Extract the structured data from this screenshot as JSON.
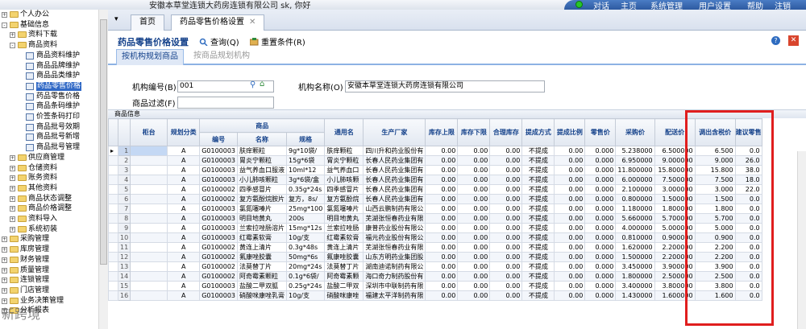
{
  "topbar": {
    "company_user": "安徽本草堂连锁大药房连锁有限公司   sk, 你好",
    "nav": [
      "对话",
      "主页",
      "系统管理",
      "用户设置",
      "帮助",
      "注销"
    ]
  },
  "sidebar": {
    "items": [
      {
        "label": "个人办公",
        "type": "folder",
        "level": 0,
        "expand": "+"
      },
      {
        "label": "基础信息",
        "type": "folder",
        "level": 0,
        "expand": "-"
      },
      {
        "label": "资料下载",
        "type": "folder",
        "level": 1,
        "expand": "+"
      },
      {
        "label": "商品资料",
        "type": "folder",
        "level": 1,
        "expand": "-"
      },
      {
        "label": "商品资料维护",
        "type": "doc",
        "level": 2
      },
      {
        "label": "商品品牌维护",
        "type": "doc",
        "level": 2
      },
      {
        "label": "商品品类维护",
        "type": "doc",
        "level": 2
      },
      {
        "label": "药品零售价格",
        "type": "doc",
        "level": 2,
        "selected": true
      },
      {
        "label": "药品零售价格",
        "type": "doc",
        "level": 2
      },
      {
        "label": "商品条码维护",
        "type": "doc",
        "level": 2
      },
      {
        "label": "价签条码打印",
        "type": "doc",
        "level": 2
      },
      {
        "label": "商品批号效期",
        "type": "doc",
        "level": 2
      },
      {
        "label": "商品批号新增",
        "type": "doc",
        "level": 2
      },
      {
        "label": "商品批号管理",
        "type": "doc",
        "level": 2
      },
      {
        "label": "供应商管理",
        "type": "folder",
        "level": 1,
        "expand": "+"
      },
      {
        "label": "仓储资料",
        "type": "folder",
        "level": 1,
        "expand": "+"
      },
      {
        "label": "账务资料",
        "type": "folder",
        "level": 1,
        "expand": "+"
      },
      {
        "label": "其他资料",
        "type": "folder",
        "level": 1,
        "expand": "+"
      },
      {
        "label": "商品状态调整",
        "type": "folder",
        "level": 1,
        "expand": "+"
      },
      {
        "label": "商品价格调整",
        "type": "folder",
        "level": 1,
        "expand": "+"
      },
      {
        "label": "资料导入",
        "type": "folder",
        "level": 1,
        "expand": "+"
      },
      {
        "label": "系统初装",
        "type": "folder",
        "level": 1,
        "expand": "+"
      },
      {
        "label": "采购管理",
        "type": "folder",
        "level": 0,
        "expand": "+"
      },
      {
        "label": "库房管理",
        "type": "folder",
        "level": 0,
        "expand": "+"
      },
      {
        "label": "财务管理",
        "type": "folder",
        "level": 0,
        "expand": "+"
      },
      {
        "label": "质量管理",
        "type": "folder",
        "level": 0,
        "expand": "+"
      },
      {
        "label": "连锁管理",
        "type": "folder",
        "level": 0,
        "expand": "+"
      },
      {
        "label": "门店管理",
        "type": "folder",
        "level": 0,
        "expand": "+"
      },
      {
        "label": "业务决策管理",
        "type": "folder",
        "level": 0,
        "expand": "+"
      },
      {
        "label": "分析报表",
        "type": "folder",
        "level": 0,
        "expand": "+"
      }
    ]
  },
  "tabs": {
    "arrow": "▾",
    "home": "首页",
    "current": "药品零售价格设置",
    "close": "✕"
  },
  "toolbar": {
    "title": "药品零售价格设置",
    "query": "查询(Q)",
    "reset": "重置条件(R)",
    "help": "?",
    "close": "✕"
  },
  "subtabs": {
    "active": "按机构规划商品",
    "inactive": "按商品规划机构"
  },
  "form": {
    "org_code_label": "机构编号(B)",
    "org_code_value": "001",
    "org_name_label": "机构名称(O)",
    "org_name_value": "安徽本草堂连锁大药房连锁有限公司",
    "filter_label": "商品过滤(F)",
    "filter_value": ""
  },
  "grid": {
    "section_title": "商品信息",
    "headers": {
      "shelf": "柜台",
      "plan_class": "规划分类",
      "product_group": "商品",
      "code": "编号",
      "name": "名称",
      "spec": "规格",
      "generic": "通用名",
      "maker": "生产厂家",
      "stock_max": "库存上限",
      "stock_min": "库存下限",
      "reasonable_stock": "合理库存",
      "comm_method": "提成方式",
      "comm_ratio": "提成比例",
      "retail_price": "零售价",
      "purchase_price": "采购价",
      "delivery_price": "配送价",
      "transfer_tax_price": "调出含税价",
      "suggest_retail": "建议零售"
    },
    "rows": [
      {
        "n": "1",
        "cls": "A",
        "code": "G0100003",
        "name": "肤痒颗粒",
        "spec": "9g*10袋/",
        "generic": "肤痒颗粒",
        "maker": "四川升和药业股份有",
        "max": "0.00",
        "min": "0.00",
        "reason": "0.00",
        "method": "不提成",
        "ratio": "0.00",
        "retail": "0.000",
        "purchase": "5.238000",
        "delivery": "6.500000",
        "transfer": "6.500",
        "suggest": "0.0"
      },
      {
        "n": "2",
        "cls": "A",
        "code": "G0100003",
        "name": "胃炎宁颗粒",
        "spec": "15g*6袋",
        "generic": "胃炎宁颗粒",
        "maker": "长春人民药业集团有",
        "max": "0.00",
        "min": "0.00",
        "reason": "0.00",
        "method": "不提成",
        "ratio": "0.00",
        "retail": "0.000",
        "purchase": "6.950000",
        "delivery": "9.000000",
        "transfer": "9.000",
        "suggest": "26.0"
      },
      {
        "n": "3",
        "cls": "A",
        "code": "G0100003",
        "name": "益气养血口服液",
        "spec": "10ml*12",
        "generic": "益气养血口",
        "maker": "长春人民药业集团有",
        "max": "0.00",
        "min": "0.00",
        "reason": "0.00",
        "method": "不提成",
        "ratio": "0.00",
        "retail": "0.000",
        "purchase": "11.800000",
        "delivery": "15.800000",
        "transfer": "15.800",
        "suggest": "38.0"
      },
      {
        "n": "4",
        "cls": "A",
        "code": "G0100003",
        "name": "小儿肺咳颗粒",
        "spec": "3g*6袋/盒",
        "generic": "小儿肺咳颗",
        "maker": "长春人民药业集团有",
        "max": "0.00",
        "min": "0.00",
        "reason": "0.00",
        "method": "不提成",
        "ratio": "0.00",
        "retail": "0.000",
        "purchase": "6.000000",
        "delivery": "7.500000",
        "transfer": "7.500",
        "suggest": "18.0"
      },
      {
        "n": "5",
        "cls": "A",
        "code": "G0100002",
        "name": "四季感冒片",
        "spec": "0.35g*24s",
        "generic": "四季感冒片",
        "maker": "长春人民药业集团有",
        "max": "0.00",
        "min": "0.00",
        "reason": "0.00",
        "method": "不提成",
        "ratio": "0.00",
        "retail": "0.000",
        "purchase": "2.100000",
        "delivery": "3.000000",
        "transfer": "3.000",
        "suggest": "22.0"
      },
      {
        "n": "6",
        "cls": "A",
        "code": "G0100002",
        "name": "复方氨酚烷胺片",
        "spec": "复方，8s/",
        "generic": "复方氨酚烷",
        "maker": "长春人民药业集团有",
        "max": "0.00",
        "min": "0.00",
        "reason": "0.00",
        "method": "不提成",
        "ratio": "0.00",
        "retail": "0.000",
        "purchase": "0.800000",
        "delivery": "1.500000",
        "transfer": "1.500",
        "suggest": "0.0"
      },
      {
        "n": "7",
        "cls": "A",
        "code": "G0100003",
        "name": "氯氮噻嗪片",
        "spec": "25mg*100",
        "generic": "氯氮噻嗪片",
        "maker": "山西云鹏制药有限公",
        "max": "0.00",
        "min": "0.00",
        "reason": "0.00",
        "method": "不提成",
        "ratio": "0.00",
        "retail": "0.000",
        "purchase": "1.180000",
        "delivery": "1.800000",
        "transfer": "1.800",
        "suggest": "0.0"
      },
      {
        "n": "8",
        "cls": "A",
        "code": "G0100003",
        "name": "明目地黄丸",
        "spec": "200s",
        "generic": "明目地黄丸",
        "maker": "芜湖张恒春药业有限",
        "max": "0.00",
        "min": "0.00",
        "reason": "0.00",
        "method": "不提成",
        "ratio": "0.00",
        "retail": "0.000",
        "purchase": "5.660000",
        "delivery": "5.700000",
        "transfer": "5.700",
        "suggest": "0.0"
      },
      {
        "n": "9",
        "cls": "A",
        "code": "G0100003",
        "name": "兰索拉唑肠溶片",
        "spec": "15mg*12s",
        "generic": "兰索拉唑肠",
        "maker": "康普药业股份有限公",
        "max": "0.00",
        "min": "0.00",
        "reason": "0.00",
        "method": "不提成",
        "ratio": "0.00",
        "retail": "0.000",
        "purchase": "4.000000",
        "delivery": "5.000000",
        "transfer": "5.000",
        "suggest": "0.0"
      },
      {
        "n": "10",
        "cls": "A",
        "code": "G0100003",
        "name": "红霉素软膏",
        "spec": "10g/支",
        "generic": "红霉素软膏",
        "maker": "福元药业股份有限公",
        "max": "0.00",
        "min": "0.00",
        "reason": "0.00",
        "method": "不提成",
        "ratio": "0.00",
        "retail": "0.000",
        "purchase": "0.810000",
        "delivery": "0.900000",
        "transfer": "0.900",
        "suggest": "0.0"
      },
      {
        "n": "11",
        "cls": "A",
        "code": "G0100002",
        "name": "黄连上清片",
        "spec": "0.3g*48s",
        "generic": "黄连上清片",
        "maker": "芜湖张恒春药业有限",
        "max": "0.00",
        "min": "0.00",
        "reason": "0.00",
        "method": "不提成",
        "ratio": "0.00",
        "retail": "0.000",
        "purchase": "1.620000",
        "delivery": "2.200000",
        "transfer": "2.200",
        "suggest": "0.0"
      },
      {
        "n": "12",
        "cls": "A",
        "code": "G0100002",
        "name": "氟康唑胶囊",
        "spec": "50mg*6s",
        "generic": "氟康唑胶囊",
        "maker": "山东方明药业集团股",
        "max": "0.00",
        "min": "0.00",
        "reason": "0.00",
        "method": "不提成",
        "ratio": "0.00",
        "retail": "0.000",
        "purchase": "1.500000",
        "delivery": "2.200000",
        "transfer": "2.200",
        "suggest": "0.0"
      },
      {
        "n": "13",
        "cls": "A",
        "code": "G0100002",
        "name": "法莫替丁片",
        "spec": "20mg*24s",
        "generic": "法莫替丁片",
        "maker": "湖南迪诺制药有限公",
        "max": "0.00",
        "min": "0.00",
        "reason": "0.00",
        "method": "不提成",
        "ratio": "0.00",
        "retail": "0.000",
        "purchase": "3.450000",
        "delivery": "3.900000",
        "transfer": "3.900",
        "suggest": "0.0"
      },
      {
        "n": "14",
        "cls": "A",
        "code": "G0100002",
        "name": "阿奇霉素颗粒",
        "spec": "0.1g*6袋/",
        "generic": "阿奇霉素颗",
        "maker": "海口奇力制药股份有",
        "max": "0.00",
        "min": "0.00",
        "reason": "0.00",
        "method": "不提成",
        "ratio": "0.00",
        "retail": "0.000",
        "purchase": "1.800000",
        "delivery": "2.500000",
        "transfer": "2.500",
        "suggest": "0.0"
      },
      {
        "n": "15",
        "cls": "A",
        "code": "G0100003",
        "name": "盐酸二甲双胍",
        "spec": "0.25g*24s",
        "generic": "盐酸二甲双",
        "maker": "深圳市中联制药有限",
        "max": "0.00",
        "min": "0.00",
        "reason": "0.00",
        "method": "不提成",
        "ratio": "0.00",
        "retail": "0.000",
        "purchase": "3.400000",
        "delivery": "3.800000",
        "transfer": "3.800",
        "suggest": "0.0"
      },
      {
        "n": "16",
        "cls": "A",
        "code": "G0100003",
        "name": "硝酸咪康唑乳膏",
        "spec": "10g/支",
        "generic": "硝酸咪康唑",
        "maker": "福建太平洋制药有限",
        "max": "0.00",
        "min": "0.00",
        "reason": "0.00",
        "method": "不提成",
        "ratio": "0.00",
        "retail": "0.000",
        "purchase": "1.430000",
        "delivery": "1.600000",
        "transfer": "1.600",
        "suggest": "0.0"
      }
    ]
  },
  "watermark": "新跨境",
  "colors": {
    "accent": "#15428b",
    "highlight_box": "#e01e1e",
    "selection": "#3169c6"
  }
}
